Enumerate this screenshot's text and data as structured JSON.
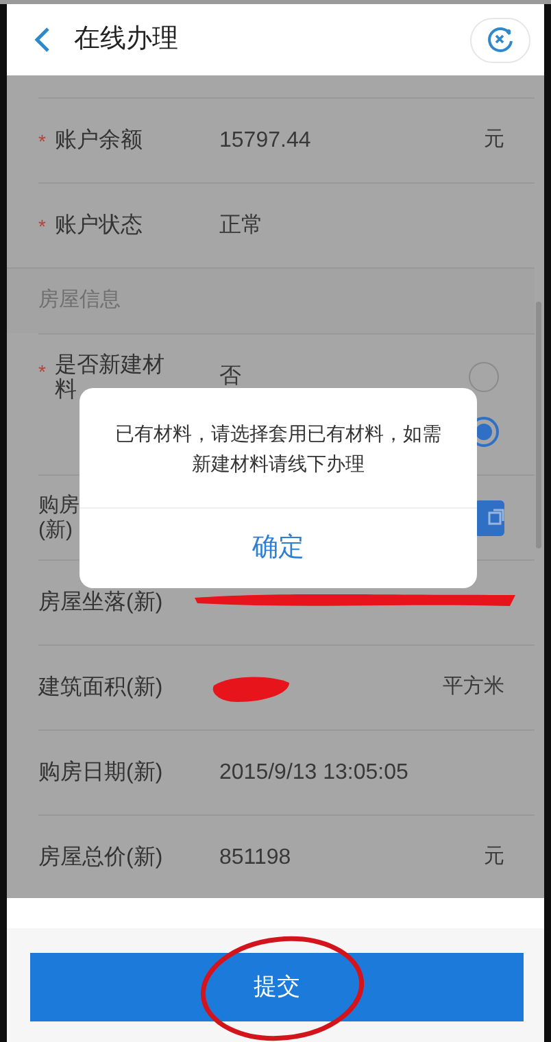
{
  "header": {
    "title": "在线办理"
  },
  "form": [
    {
      "kind": "field",
      "required_mark": "*",
      "label": "账户余额",
      "value": "15797.44",
      "unit": "元",
      "redacted": false
    },
    {
      "kind": "field",
      "required_mark": "*",
      "label": "账户状态",
      "value": "正常",
      "redacted": false
    },
    {
      "kind": "section",
      "label": "房屋信息"
    },
    {
      "kind": "radio",
      "required_mark": "*",
      "label": "是否新建材料",
      "options": [
        {
          "label": "否",
          "selected": false
        },
        {
          "selected": true
        }
      ]
    },
    {
      "kind": "picker",
      "label_lines": [
        "购房",
        "(新)"
      ]
    },
    {
      "kind": "field",
      "label": "房屋坐落(新)",
      "redacted": true
    },
    {
      "kind": "field",
      "label": "建筑面积(新)",
      "unit": "平方米",
      "redacted": true
    },
    {
      "kind": "field",
      "label": "购房日期(新)",
      "value": "2015/9/13 13:05:05",
      "redacted": false
    },
    {
      "kind": "field",
      "label": "房屋总价(新)",
      "value": "851198",
      "unit": "元",
      "redacted": false
    }
  ],
  "dialog": {
    "message": "已有材料，请选择套用已有材料，如需新建材料请线下办理",
    "button": "确定"
  },
  "submit": {
    "label": "提交",
    "circled": true
  }
}
